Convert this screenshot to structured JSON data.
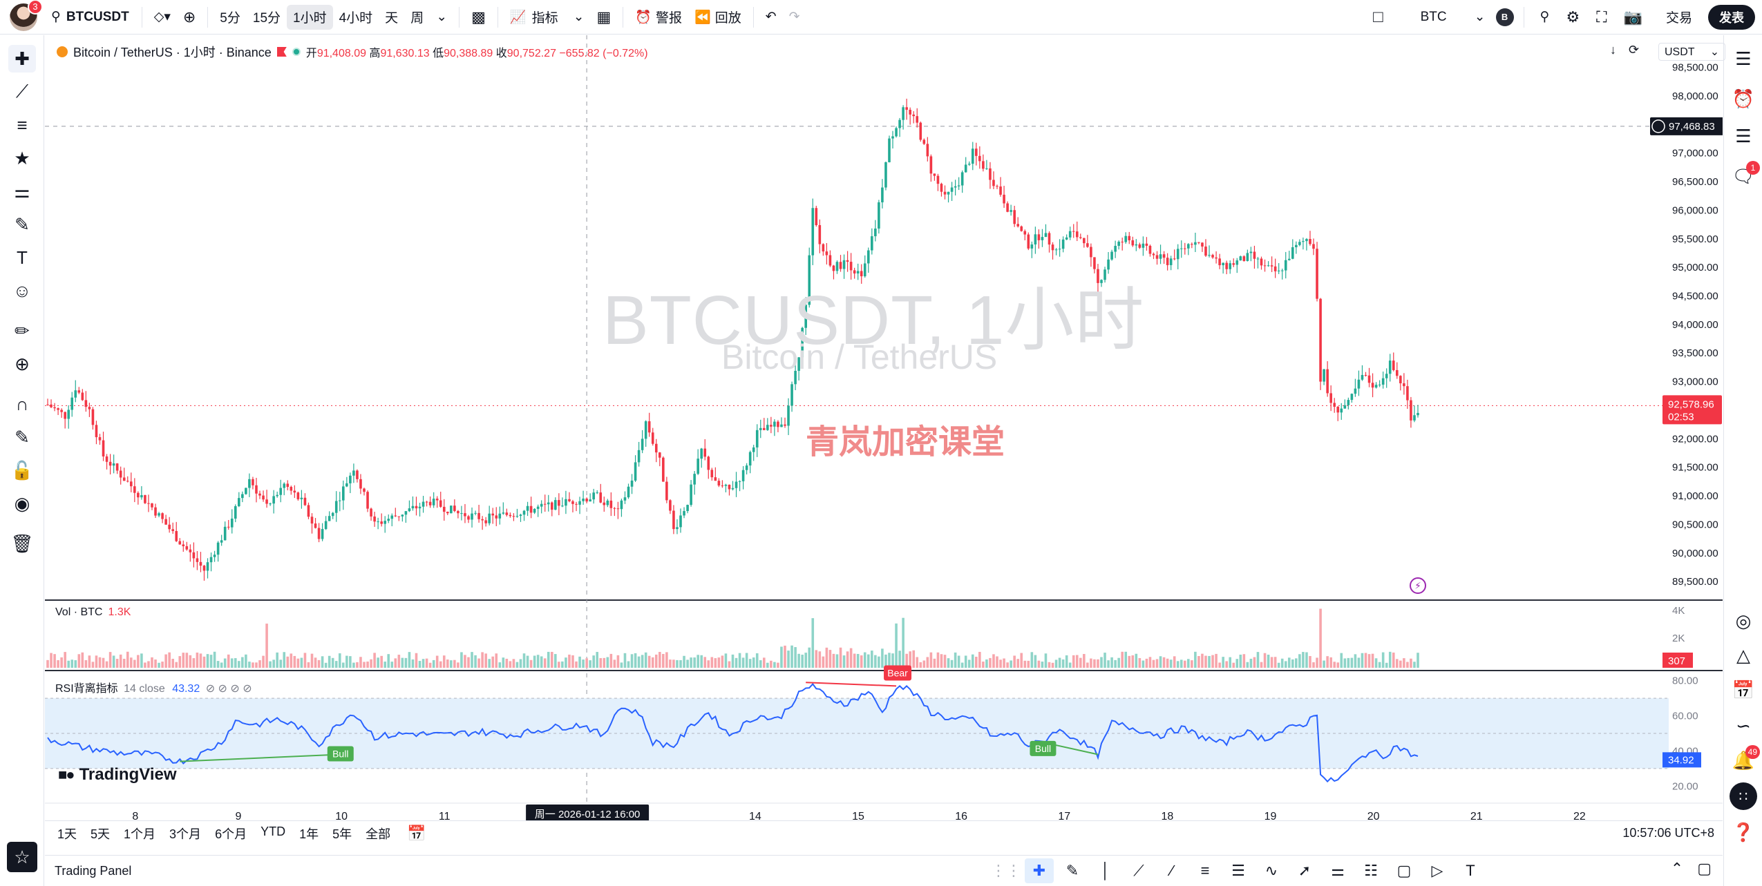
{
  "header": {
    "avatar_badge": "3",
    "symbol": "BTCUSDT",
    "intervals": [
      {
        "label": "5分",
        "active": false
      },
      {
        "label": "15分",
        "active": false
      },
      {
        "label": "1小时",
        "active": true
      },
      {
        "label": "4小时",
        "active": false
      },
      {
        "label": "天",
        "active": false
      },
      {
        "label": "周",
        "active": false
      }
    ],
    "indicators_label": "指标",
    "alert_label": "警报",
    "replay_label": "回放",
    "currency": "BTC",
    "currency_badge": "B",
    "trade_label": "交易",
    "publish_label": "发表"
  },
  "legend": {
    "title": "Bitcoin / TetherUS · 1小时 · Binance",
    "open_label": "开",
    "open": "91,408.09",
    "high_label": "高",
    "high": "91,630.13",
    "low_label": "低",
    "low": "90,388.89",
    "close_label": "收",
    "close": "90,752.27",
    "change": "−655.82 (−0.72%)"
  },
  "watermark": {
    "line1": "BTCUSDT, 1小时",
    "line2": "Bitcoin / TetherUS"
  },
  "brand_watermark": "青岚加密课堂",
  "unit": "USDT",
  "price_axis": {
    "labels": [
      "98,500.00",
      "98,000.00",
      "97,000.00",
      "96,500.00",
      "96,000.00",
      "95,500.00",
      "95,000.00",
      "94,500.00",
      "94,000.00",
      "93,500.00",
      "93,000.00",
      "92,000.00",
      "91,500.00",
      "91,000.00",
      "90,500.00",
      "90,000.00",
      "89,500.00"
    ],
    "crosshair_price": "97,468.83",
    "last_price": "92,578.96",
    "countdown": "02:53"
  },
  "volume": {
    "label": "Vol · BTC",
    "value": "1.3K",
    "axis": [
      "4K",
      "2K"
    ],
    "last": "307"
  },
  "rsi": {
    "label": "RSI背离指标",
    "params": "14 close",
    "value": "43.32",
    "axis": [
      "80.00",
      "60.00",
      "40.00",
      "20.00"
    ],
    "last": "34.92",
    "bear_label": "Bear",
    "bull_label": "Bull"
  },
  "time_axis": {
    "labels": [
      {
        "text": "8",
        "x": 0.039
      },
      {
        "text": "9",
        "x": 0.103
      },
      {
        "text": "10",
        "x": 0.167
      },
      {
        "text": "11",
        "x": 0.231
      },
      {
        "text": "12",
        "x": 0.295
      },
      {
        "text": "14",
        "x": 0.424
      },
      {
        "text": "15",
        "x": 0.488
      },
      {
        "text": "16",
        "x": 0.552
      },
      {
        "text": "17",
        "x": 0.616
      },
      {
        "text": "18",
        "x": 0.68
      },
      {
        "text": "19",
        "x": 0.744
      },
      {
        "text": "20",
        "x": 0.808
      },
      {
        "text": "21",
        "x": 0.872
      },
      {
        "text": "22",
        "x": 0.936
      }
    ],
    "crosshair_label": "周一 2026-01-12   16:00"
  },
  "tradingview_logo": "TradingView",
  "ranges": [
    "1天",
    "5天",
    "1个月",
    "3个月",
    "6个月",
    "YTD",
    "1年",
    "5年",
    "全部"
  ],
  "clock": "10:57:06 UTC+8",
  "trading_panel_label": "Trading Panel",
  "right_badges": {
    "chat": "1",
    "notifications": "49"
  },
  "colors": {
    "up": "#22ab94",
    "down": "#f23645",
    "rsi_line": "#2962ff",
    "rsi_band": "#e3f0fc"
  },
  "chart_data": {
    "type": "candlestick",
    "title": "Bitcoin / TetherUS · 1小时 · Binance",
    "ylim": [
      89200,
      98700
    ],
    "anchors": [
      [
        0,
        92600
      ],
      [
        5,
        92400
      ],
      [
        8,
        92900
      ],
      [
        12,
        92500
      ],
      [
        16,
        91700
      ],
      [
        22,
        91300
      ],
      [
        30,
        90800
      ],
      [
        38,
        90200
      ],
      [
        45,
        89700
      ],
      [
        52,
        90500
      ],
      [
        58,
        91300
      ],
      [
        63,
        90800
      ],
      [
        68,
        91200
      ],
      [
        73,
        90900
      ],
      [
        78,
        90300
      ],
      [
        84,
        91000
      ],
      [
        88,
        91500
      ],
      [
        94,
        90500
      ],
      [
        102,
        90700
      ],
      [
        110,
        90900
      ],
      [
        118,
        90700
      ],
      [
        126,
        90600
      ],
      [
        134,
        90700
      ],
      [
        142,
        90800
      ],
      [
        150,
        90900
      ],
      [
        158,
        91000
      ],
      [
        164,
        90700
      ],
      [
        168,
        91300
      ],
      [
        172,
        92300
      ],
      [
        176,
        91600
      ],
      [
        180,
        90400
      ],
      [
        184,
        90900
      ],
      [
        188,
        91800
      ],
      [
        192,
        91200
      ],
      [
        196,
        91100
      ],
      [
        200,
        91400
      ],
      [
        204,
        92100
      ],
      [
        208,
        92200
      ],
      [
        212,
        92300
      ],
      [
        216,
        93500
      ],
      [
        218,
        94300
      ],
      [
        220,
        96000
      ],
      [
        222,
        95400
      ],
      [
        226,
        95000
      ],
      [
        230,
        95100
      ],
      [
        234,
        94800
      ],
      [
        238,
        95700
      ],
      [
        242,
        97200
      ],
      [
        246,
        97800
      ],
      [
        250,
        97500
      ],
      [
        254,
        96700
      ],
      [
        258,
        96200
      ],
      [
        262,
        96500
      ],
      [
        266,
        97000
      ],
      [
        270,
        96700
      ],
      [
        274,
        96300
      ],
      [
        278,
        95800
      ],
      [
        282,
        95400
      ],
      [
        286,
        95600
      ],
      [
        290,
        95300
      ],
      [
        294,
        95600
      ],
      [
        298,
        95500
      ],
      [
        302,
        94700
      ],
      [
        306,
        95300
      ],
      [
        310,
        95500
      ],
      [
        314,
        95400
      ],
      [
        318,
        95200
      ],
      [
        322,
        95100
      ],
      [
        326,
        95300
      ],
      [
        330,
        95500
      ],
      [
        334,
        95200
      ],
      [
        338,
        95000
      ],
      [
        342,
        95100
      ],
      [
        346,
        95200
      ],
      [
        350,
        95000
      ],
      [
        354,
        94900
      ],
      [
        358,
        95300
      ],
      [
        362,
        95500
      ],
      [
        364,
        95400
      ],
      [
        366,
        93500
      ],
      [
        368,
        92800
      ],
      [
        370,
        92500
      ],
      [
        374,
        92600
      ],
      [
        378,
        93100
      ],
      [
        382,
        92900
      ],
      [
        386,
        93300
      ],
      [
        390,
        92900
      ],
      [
        392,
        92400
      ],
      [
        394,
        92500
      ]
    ],
    "rsi_points": [
      [
        0,
        47
      ],
      [
        10,
        42
      ],
      [
        20,
        39
      ],
      [
        30,
        38
      ],
      [
        38,
        34
      ],
      [
        44,
        38
      ],
      [
        50,
        45
      ],
      [
        54,
        57
      ],
      [
        60,
        55
      ],
      [
        66,
        58
      ],
      [
        72,
        54
      ],
      [
        78,
        44
      ],
      [
        84,
        56
      ],
      [
        88,
        62
      ],
      [
        94,
        48
      ],
      [
        104,
        50
      ],
      [
        114,
        49
      ],
      [
        124,
        51
      ],
      [
        134,
        49
      ],
      [
        144,
        53
      ],
      [
        154,
        55
      ],
      [
        160,
        48
      ],
      [
        164,
        65
      ],
      [
        170,
        62
      ],
      [
        174,
        45
      ],
      [
        180,
        43
      ],
      [
        186,
        56
      ],
      [
        190,
        62
      ],
      [
        196,
        49
      ],
      [
        204,
        60
      ],
      [
        210,
        58
      ],
      [
        216,
        72
      ],
      [
        220,
        78
      ],
      [
        224,
        70
      ],
      [
        230,
        67
      ],
      [
        236,
        74
      ],
      [
        240,
        62
      ],
      [
        244,
        77
      ],
      [
        248,
        75
      ],
      [
        254,
        62
      ],
      [
        260,
        58
      ],
      [
        266,
        58
      ],
      [
        272,
        48
      ],
      [
        278,
        50
      ],
      [
        282,
        43
      ],
      [
        286,
        45
      ],
      [
        290,
        52
      ],
      [
        296,
        47
      ],
      [
        302,
        38
      ],
      [
        306,
        56
      ],
      [
        314,
        52
      ],
      [
        320,
        49
      ],
      [
        326,
        53
      ],
      [
        332,
        48
      ],
      [
        338,
        44
      ],
      [
        344,
        51
      ],
      [
        350,
        47
      ],
      [
        356,
        52
      ],
      [
        362,
        56
      ],
      [
        365,
        62
      ],
      [
        366,
        28
      ],
      [
        368,
        22
      ],
      [
        372,
        25
      ],
      [
        376,
        33
      ],
      [
        380,
        40
      ],
      [
        384,
        37
      ],
      [
        388,
        43
      ],
      [
        392,
        38
      ],
      [
        394,
        37
      ]
    ]
  }
}
